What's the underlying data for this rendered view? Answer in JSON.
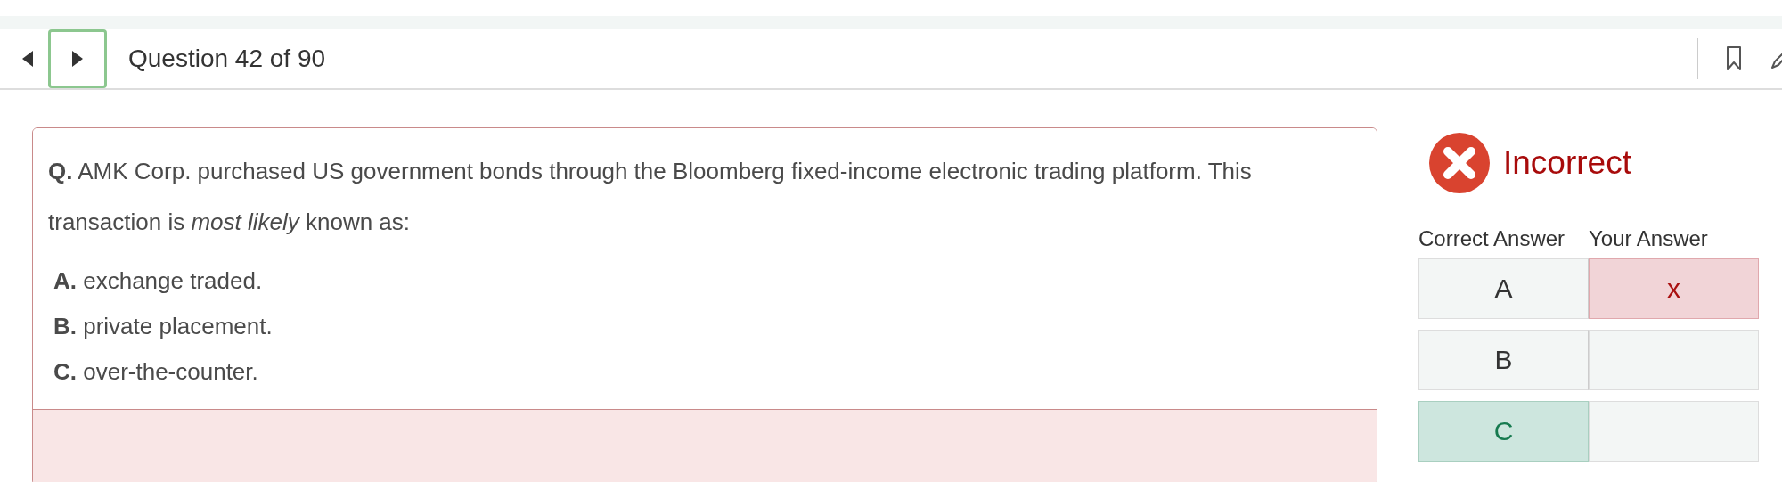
{
  "nav": {
    "title": "Question 42 of 90",
    "next_focused": true
  },
  "question": {
    "text": "**Q.** AMK Corp. purchased US government bonds through the Bloomberg fixed-income electronic trading platform. This transaction is *most likely* known as:",
    "options": [
      {
        "text": "**A.** exchange traded."
      },
      {
        "text": "**B.** private placement."
      },
      {
        "text": "**C.** over-the-counter."
      }
    ]
  },
  "result": {
    "status": "Incorrect",
    "correct": false,
    "columns": [
      "Correct Answer",
      "Your Answer"
    ],
    "rows": [
      {
        "correct_answer": "A",
        "is_correct": false,
        "your_answer": "x",
        "chosen": true
      },
      {
        "correct_answer": "B",
        "is_correct": false,
        "chosen": false
      },
      {
        "correct_answer": "C",
        "is_correct": true,
        "chosen": false
      }
    ]
  }
}
